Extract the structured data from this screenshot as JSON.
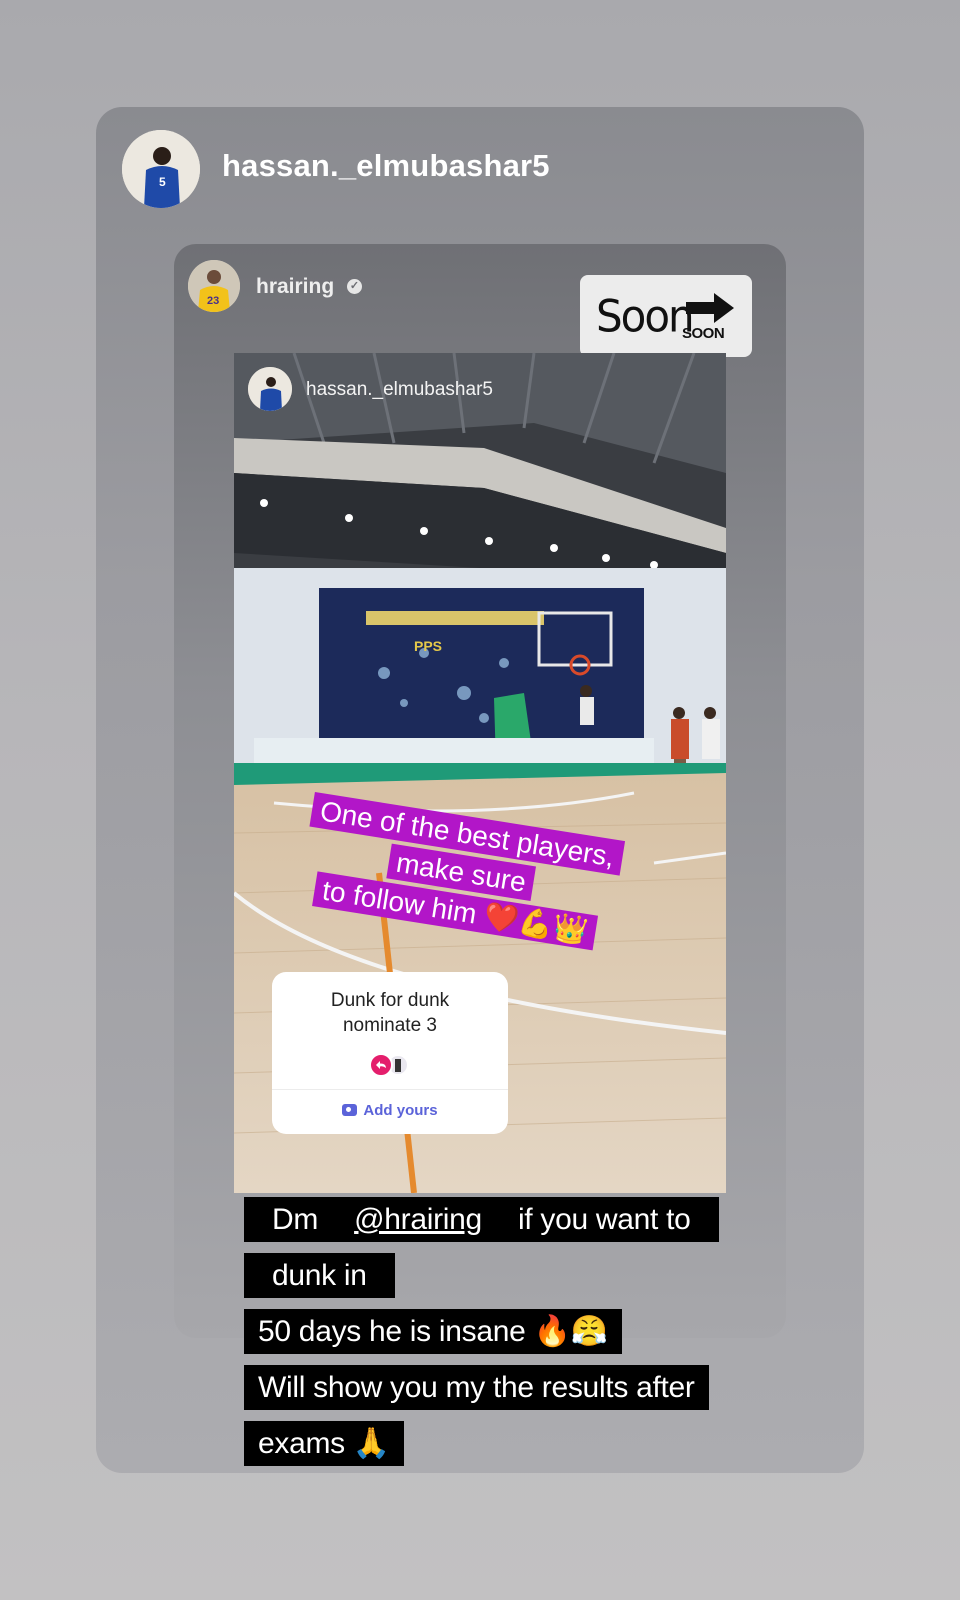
{
  "story": {
    "owner_username": "hassan._elmubashar5"
  },
  "shared_story": {
    "username": "hrairing",
    "verified_icon": "verified-badge-icon",
    "soon_sticker": {
      "text": "Soon",
      "small_text": "SOON",
      "icon": "right-arrow-icon"
    },
    "video": {
      "username": "hassan._elmubashar5",
      "caption_lines": [
        "One of the best players, make sure",
        "to follow him ❤️💪👑"
      ],
      "add_yours": {
        "prompt": "Dunk for dunk\nnominate 3",
        "button_label": "Add yours",
        "button_icon": "camera-icon"
      }
    }
  },
  "caption": {
    "line1_prefix": "Dm ",
    "mention": "@hrairing",
    "line1_suffix": " if you want to dunk in",
    "line2": "50 days he is insane 🔥😤",
    "line3": "Will show you my the results after",
    "line4": "exams 🙏"
  },
  "colors": {
    "caption_purple": "#b216c8",
    "add_yours_blue": "#5b63d9"
  }
}
